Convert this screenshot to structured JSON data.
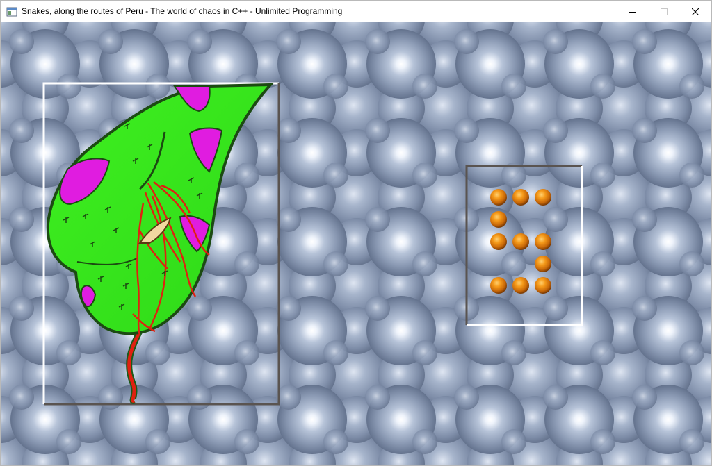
{
  "window": {
    "title": "Snakes, along the routes of Peru - The world of chaos in C++ - Unlimited Programming"
  },
  "controls": {
    "minimize_icon": "minimize-icon",
    "maximize_icon": "maximize-icon",
    "close_icon": "close-icon"
  },
  "scene": {
    "background": "tiled chrome bubble texture",
    "snake_frame": {
      "content": "green snake head with magenta spots and red veins"
    },
    "preview_frame": {
      "content": "orange balls forming the digit 5"
    }
  },
  "colors": {
    "snake_green": "#33e51a",
    "snake_spot": "#e01ce0",
    "snake_vein": "#e02010",
    "ball": "#f08a10",
    "frame_light": "#ffffff",
    "frame_dark": "#5a5450",
    "background": "#8e9cb4"
  }
}
